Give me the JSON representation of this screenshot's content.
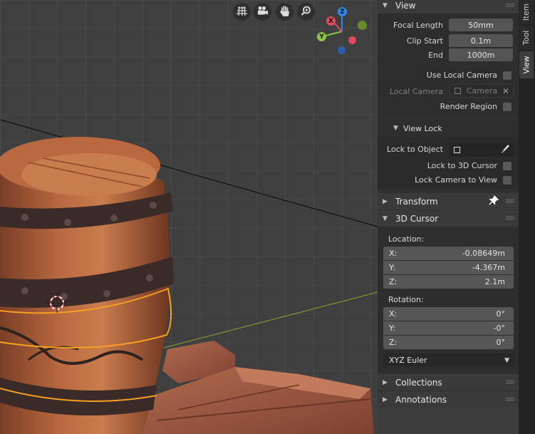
{
  "navigate": {
    "icons": [
      "grid-view-icon",
      "camera-view-icon",
      "hand-pan-icon",
      "zoom-icon"
    ]
  },
  "gizmo": {
    "z_label": "Z",
    "y_label": "Y",
    "x_label": "X"
  },
  "tabs": [
    "Item",
    "Tool",
    "View"
  ],
  "active_tab": "View",
  "view_panel": {
    "title": "View",
    "focal_length_label": "Focal Length",
    "focal_length_value": "50mm",
    "clip_start_label": "Clip Start",
    "clip_start_value": "0.1m",
    "clip_end_label": "End",
    "clip_end_value": "1000m",
    "use_local_camera_label": "Use Local Camera",
    "local_camera_label": "Local Camera",
    "local_camera_value": "Camera",
    "render_region_label": "Render Region"
  },
  "view_lock": {
    "title": "View Lock",
    "lock_to_object_label": "Lock to Object",
    "lock_to_cursor_label": "Lock to 3D Cursor",
    "lock_camera_label": "Lock Camera to View"
  },
  "transform_panel": {
    "title": "Transform"
  },
  "cursor_panel": {
    "title": "3D Cursor",
    "location_label": "Location:",
    "location": [
      {
        "axis": "X:",
        "value": "-0.08649m"
      },
      {
        "axis": "Y:",
        "value": "-4.367m"
      },
      {
        "axis": "Z:",
        "value": "2.1m"
      }
    ],
    "rotation_label": "Rotation:",
    "rotation": [
      {
        "axis": "X:",
        "value": "0°"
      },
      {
        "axis": "Y:",
        "value": "-0°"
      },
      {
        "axis": "Z:",
        "value": "0°"
      }
    ],
    "rotation_mode": "XYZ Euler"
  },
  "collections_panel": {
    "title": "Collections"
  },
  "annotations_panel": {
    "title": "Annotations"
  },
  "colors": {
    "axis_x": "#e04a5f",
    "axis_y": "#8bc34a",
    "axis_z": "#2f86e6",
    "selection_outline": "#f5a020"
  }
}
